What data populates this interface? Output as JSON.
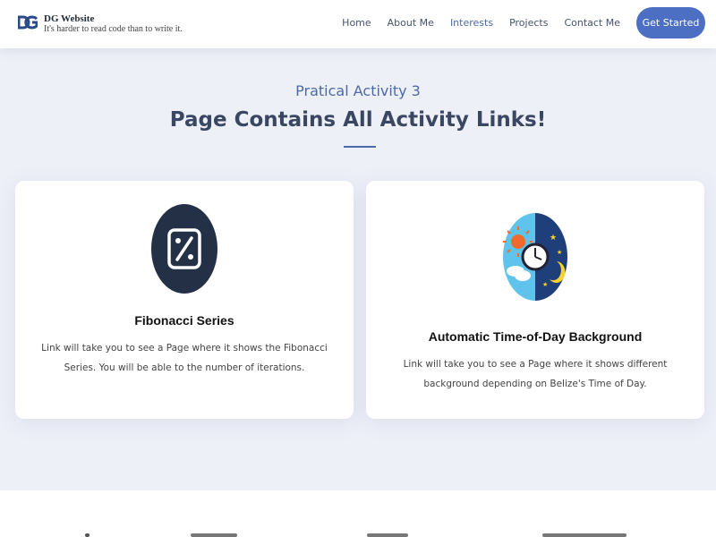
{
  "header": {
    "brand_title": "DG Website",
    "brand_tagline": "It's harder to read code than to write it.",
    "nav": [
      {
        "label": "Home",
        "active": false
      },
      {
        "label": "About Me",
        "active": false
      },
      {
        "label": "Interests",
        "active": true
      },
      {
        "label": "Projects",
        "active": false
      },
      {
        "label": "Contact Me",
        "active": false
      }
    ],
    "cta_label": "Get Started"
  },
  "section": {
    "subtitle": "Pratical Activity 3",
    "title": "Page Contains All Activity Links!"
  },
  "cards": [
    {
      "icon": "percent-icon",
      "title": "Fibonacci Series",
      "description": "Link will take you to see a Page where it shows the Fibonacci Series. You will be able to the number of iterations."
    },
    {
      "icon": "day-night-clock-icon",
      "title": "Automatic Time-of-Day Background",
      "description": "Link will take you to see a Page where it shows different background depending on Belize's Time of Day."
    }
  ],
  "colors": {
    "accent": "#4c6fc4",
    "section_bg": "#eef0f8",
    "heading": "#3a4763",
    "subheading": "#4c6aa6"
  }
}
